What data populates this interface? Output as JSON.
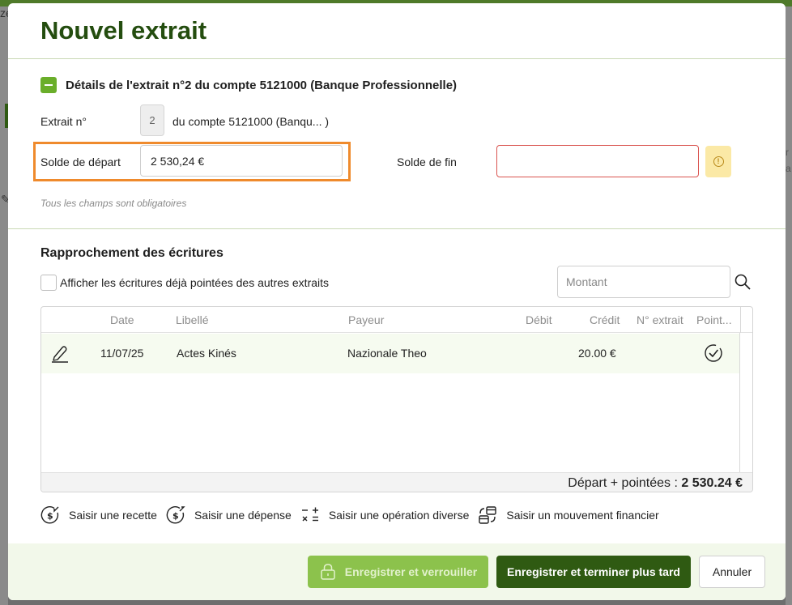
{
  "background": {
    "left_fragment": "ze",
    "right_fragment_1": "r",
    "right_fragment_2": "a"
  },
  "modal": {
    "title": "Nouvel extrait",
    "section_title": "Détails de l'extrait n°2 du compte 5121000 (Banque Professionnelle)",
    "extrait_label": "Extrait n°",
    "extrait_number": "2",
    "compte_text": "du compte 5121000 (Banqu... )",
    "solde_depart_label": "Solde de départ",
    "solde_depart_value": "2 530,24 €",
    "solde_fin_label": "Solde de fin",
    "solde_fin_value": "",
    "required_note": "Tous les champs sont obligatoires"
  },
  "rapprochement": {
    "title": "Rapprochement des écritures",
    "checkbox_label": "Afficher les écritures déjà pointées des autres extraits",
    "search_placeholder": "Montant"
  },
  "table": {
    "columns": [
      "Date",
      "Libellé",
      "Payeur",
      "Débit",
      "Crédit",
      "N° extrait",
      "Point..."
    ],
    "rows": [
      {
        "date": "11/07/25",
        "libelle": "Actes Kinés",
        "payeur": "Nazionale Theo",
        "debit": "",
        "credit": "20.00 €",
        "extrait": ""
      }
    ],
    "footer_label": "Départ + pointées : ",
    "footer_value": "2 530.24 €"
  },
  "actions": [
    {
      "label": "Saisir une recette",
      "icon": "recette-icon"
    },
    {
      "label": "Saisir une dépense",
      "icon": "depense-icon"
    },
    {
      "label": "Saisir une opération diverse",
      "icon": "operation-icon"
    },
    {
      "label": "Saisir un mouvement financier",
      "icon": "mouvement-icon"
    }
  ],
  "buttons": {
    "lock_label": "Enregistrer et verrouiller",
    "later_label": "Enregistrer et terminer plus tard",
    "cancel_label": "Annuler"
  },
  "colors": {
    "brand_dark": "#2f5a12",
    "brand_light": "#8cc24c",
    "highlight": "#ef8a2c",
    "error_border": "#d9534f",
    "warning_bg": "#fbe9a6"
  }
}
